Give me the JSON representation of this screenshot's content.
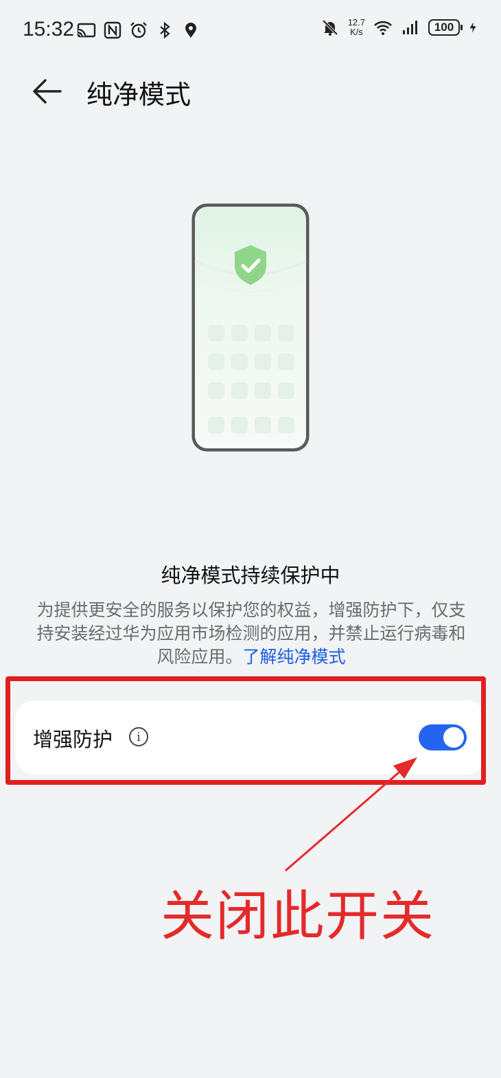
{
  "status_bar": {
    "time": "15:32",
    "net_speed_value": "12.7",
    "net_speed_unit": "K/s",
    "battery": "100",
    "icons_left": [
      "cast-icon",
      "nfc-icon",
      "alarm-icon",
      "bluetooth-icon",
      "location-icon"
    ],
    "icons_right": [
      "mute-icon",
      "wifi-icon",
      "signal-icon",
      "battery-icon",
      "charging-icon"
    ]
  },
  "header": {
    "title": "纯净模式",
    "back_icon": "arrow-left-icon"
  },
  "info": {
    "title": "纯净模式持续保护中",
    "description": "为提供更安全的服务以保护您的权益，增强防护下，仅支持安装经过华为应用市场检测的应用，并禁止运行病毒和风险应用。",
    "link_text": "了解纯净模式"
  },
  "setting": {
    "label": "增强防护",
    "info_icon": "info-icon",
    "toggle_on": true
  },
  "annotation": {
    "text": "关闭此开关"
  },
  "colors": {
    "background": "#f1f3f5",
    "accent_blue": "#2464f0",
    "link_blue": "#1b5fe0",
    "annotation_red": "#e42a2a",
    "shield_green": "#8fd68a"
  }
}
